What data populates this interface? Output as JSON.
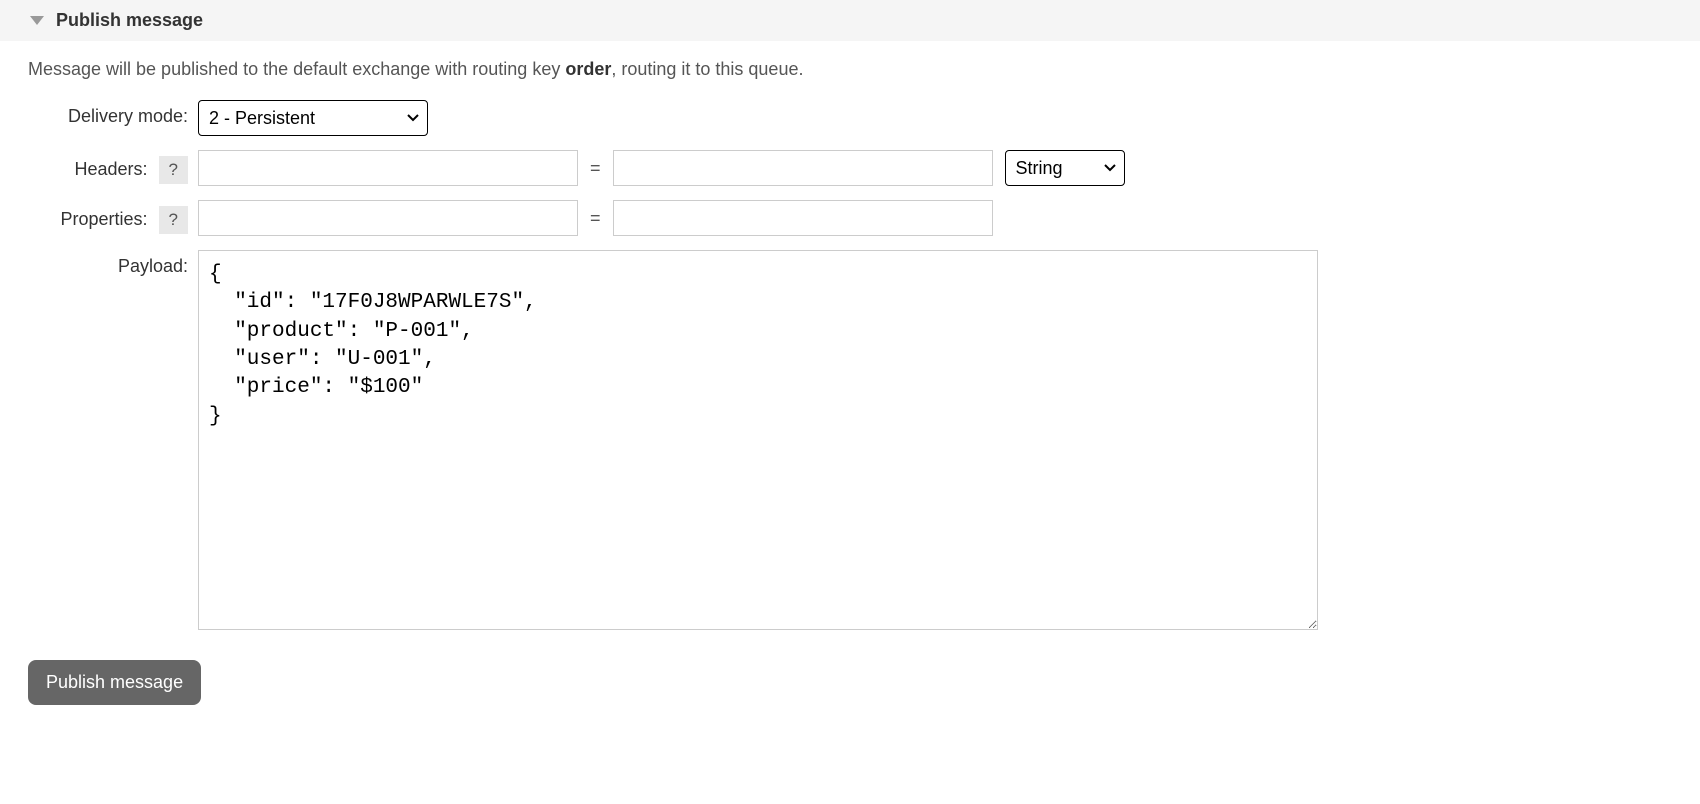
{
  "section": {
    "title": "Publish message"
  },
  "info": {
    "prefix": "Message will be published to the default exchange with routing key ",
    "routing_key": "order",
    "suffix": ", routing it to this queue."
  },
  "form": {
    "delivery_mode": {
      "label": "Delivery mode:",
      "selected": "2 - Persistent"
    },
    "headers": {
      "label": "Headers:",
      "help": "?",
      "key": "",
      "value": "",
      "type_selected": "String"
    },
    "properties": {
      "label": "Properties:",
      "help": "?",
      "key": "",
      "value": ""
    },
    "payload": {
      "label": "Payload:",
      "value": "{\n  \"id\": \"17F0J8WPARWLE7S\",\n  \"product\": \"P-001\",\n  \"user\": \"U-001\",\n  \"price\": \"$100\"\n}"
    },
    "submit_label": "Publish message"
  }
}
